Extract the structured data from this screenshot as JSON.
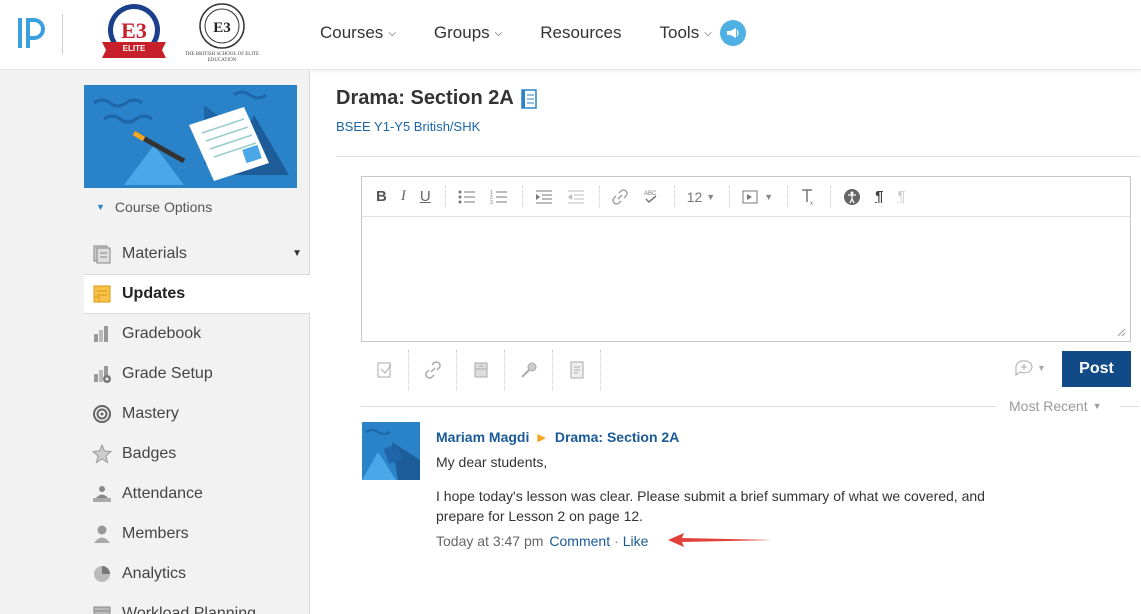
{
  "topbar": {
    "nav": [
      {
        "label": "Courses",
        "dropdown": true
      },
      {
        "label": "Groups",
        "dropdown": true
      },
      {
        "label": "Resources",
        "dropdown": false
      },
      {
        "label": "Tools",
        "dropdown": true
      }
    ],
    "school_logo_caption": "THE BRITISH SCHOOL OF ELITE EDUCATION",
    "colors": {
      "brand": "#114a86",
      "accent": "#2a83c9",
      "notif": "#4fb0e3"
    }
  },
  "sidebar": {
    "course_options_label": "Course Options",
    "items": [
      {
        "label": "Materials",
        "icon": "materials-icon",
        "active": false
      },
      {
        "label": "Updates",
        "icon": "updates-icon",
        "active": true
      },
      {
        "label": "Gradebook",
        "icon": "gradebook-icon",
        "active": false
      },
      {
        "label": "Grade Setup",
        "icon": "grade-setup-icon",
        "active": false
      },
      {
        "label": "Mastery",
        "icon": "mastery-icon",
        "active": false
      },
      {
        "label": "Badges",
        "icon": "badges-icon",
        "active": false
      },
      {
        "label": "Attendance",
        "icon": "attendance-icon",
        "active": false
      },
      {
        "label": "Members",
        "icon": "members-icon",
        "active": false
      },
      {
        "label": "Analytics",
        "icon": "analytics-icon",
        "active": false
      },
      {
        "label": "Workload Planning",
        "icon": "workload-icon",
        "active": false
      }
    ]
  },
  "course": {
    "title": "Drama: Section 2A",
    "subtitle": "BSEE Y1-Y5 British/SHK"
  },
  "editor": {
    "font_size": "12",
    "post_label": "Post"
  },
  "feed": {
    "sort_label": "Most Recent",
    "post": {
      "author": "Mariam Magdi",
      "target": "Drama: Section 2A",
      "greeting": "My dear students,",
      "message": "I hope today's lesson was clear. Please submit a brief summary of what we covered, and prepare for Lesson 2 on page 12.",
      "timestamp": "Today at 3:47 pm",
      "comment_label": "Comment",
      "like_label": "Like"
    }
  }
}
